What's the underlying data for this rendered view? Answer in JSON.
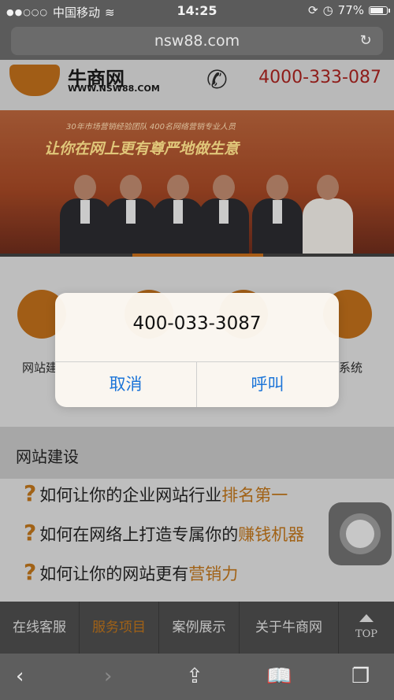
{
  "status_bar": {
    "carrier": "中国移动",
    "time": "14:25",
    "battery": "77%"
  },
  "browser": {
    "url": "nsw88.com"
  },
  "header": {
    "logo_text": "牛商网",
    "logo_url": "WWW.NSW88.COM",
    "phone": "4000-333-087"
  },
  "banner": {
    "tagline_small": "30年市场营销经验团队  400名网络营销专业人员",
    "slogan": "让你在网上更有尊严地做生意"
  },
  "icons_row": {
    "items": [
      {
        "label": "网站建"
      },
      {
        "label": ""
      },
      {
        "label": ""
      },
      {
        "label": "系统"
      }
    ]
  },
  "section": {
    "title": "网站建设",
    "items": [
      {
        "prefix": "如何让你的企业网站行业",
        "highlight": "排名第一"
      },
      {
        "prefix": "如何在网络上打造专属你的",
        "highlight": "赚钱机器"
      },
      {
        "prefix": "如何让你的网站更有",
        "highlight": "营销力"
      }
    ]
  },
  "bottom_nav": {
    "items": [
      "在线客服",
      "服务项目",
      "案例展示",
      "关于牛商网"
    ],
    "active_index": 1,
    "top_label": "TOP"
  },
  "alert": {
    "title": "400-033-3087",
    "cancel": "取消",
    "call": "呼叫"
  },
  "colors": {
    "accent_orange": "#b8701a",
    "phone_red": "#a3221e",
    "ios_blue": "#1b74d8"
  }
}
